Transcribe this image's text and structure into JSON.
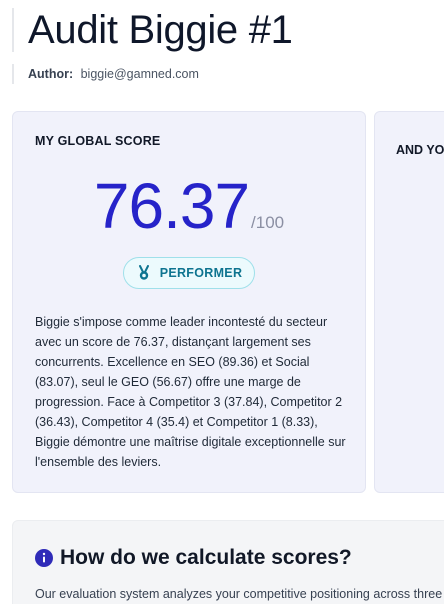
{
  "header": {
    "title": "Audit Biggie #1",
    "author_label": "Author:",
    "author_value": "biggie@gamned.com"
  },
  "global_score": {
    "label": "MY GLOBAL SCORE",
    "score": "76.37",
    "max": "/100",
    "badge": "PERFORMER",
    "badge_icon": "medal-icon",
    "summary": "Biggie s'impose comme leader incontesté du secteur avec un score de 76.37, distançant largement ses concurrents. Excellence en SEO (89.36) et Social (83.07), seul le GEO (56.67) offre une marge de progression. Face à Competitor 3 (37.84), Competitor 2 (36.43), Competitor 4 (35.4) et Competitor 1 (8.33), Biggie démontre une maîtrise digitale exceptionnelle sur l'ensemble des leviers."
  },
  "second_card": {
    "label": "AND YO"
  },
  "info": {
    "icon": "info-icon",
    "title": "How do we calculate scores?",
    "text": "Our evaluation system analyzes your competitive positioning across three m"
  },
  "colors": {
    "score": "#2623c9",
    "badge_text": "#0e7490",
    "badge_border": "#9fe0ea",
    "info_icon": "#2f2bb8"
  }
}
